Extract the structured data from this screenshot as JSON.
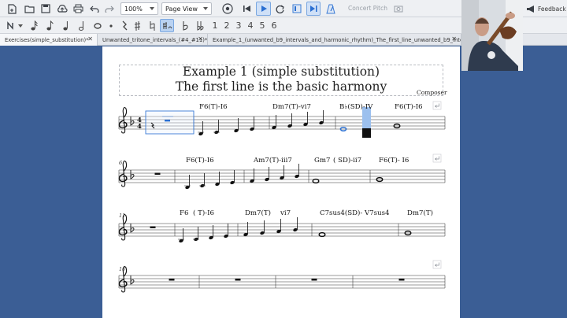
{
  "toolbar": {
    "zoom_value": "100%",
    "view_mode": "Page View",
    "concert_pitch_label": "Concert Pitch",
    "feedback_label": "Feedback"
  },
  "note_toolbar": {
    "durations": [
      "1",
      "2",
      "3",
      "4",
      "5",
      "6"
    ]
  },
  "tabs": [
    {
      "label": "Exercises(simple_substitution)*"
    },
    {
      "label": "Unwanted_tritone_intervals_(#4_#11)*"
    },
    {
      "label": "Example_1_(unwanted_b9_intervals_and_harmonic_rhythm)_The_first_line_unwanted_b9_interval"
    }
  ],
  "score": {
    "title_line1": "Example 1 (simple substitution)",
    "title_line2": "The first line is the basic harmony",
    "composer": "Composer",
    "systems": [
      {
        "measure_number": "",
        "chords": [
          "F6(T)-I6",
          "Dm7(T)-vi7",
          "B♭(SD)-IV",
          "F6(T)-I6"
        ]
      },
      {
        "measure_number": "6",
        "chords": [
          "F6(T)-I6",
          "Am7(T)-iii7",
          "Gm7",
          "( SD)-ii7",
          "F6(T)- I6"
        ]
      },
      {
        "measure_number": "11",
        "chords": [
          "F6",
          "( T)-I6",
          "Dm7(T)",
          "vi7",
          "C7sus4(SD)- V7sus4",
          "Dm7(T)"
        ]
      },
      {
        "measure_number": "16",
        "chords": []
      }
    ]
  },
  "colors": {
    "background": "#3b5e95",
    "selection": "#3a7bd5",
    "page": "#ffffff"
  }
}
